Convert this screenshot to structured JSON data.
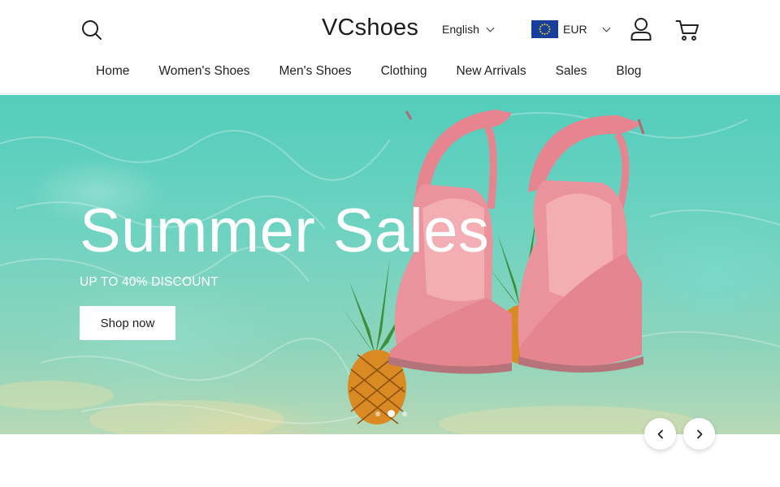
{
  "header": {
    "brand": "VCshoes",
    "language": {
      "label": "English",
      "icon": "chevron-down-icon"
    },
    "currency": {
      "code": "EUR",
      "flag": "eu-flag-icon",
      "icon": "chevron-down-icon"
    },
    "icons": {
      "search": "search-icon",
      "account": "user-icon",
      "cart": "cart-icon"
    }
  },
  "nav": {
    "items": [
      {
        "label": "Home"
      },
      {
        "label": "Women's Shoes"
      },
      {
        "label": "Men's Shoes"
      },
      {
        "label": "Clothing"
      },
      {
        "label": "New Arrivals"
      },
      {
        "label": "Sales"
      },
      {
        "label": "Blog"
      }
    ]
  },
  "hero": {
    "title": "Summer Sales",
    "subtitle": "UP TO 40% DISCOUNT",
    "cta_label": "Shop now",
    "slides_total": 3,
    "active_slide": 2
  },
  "carousel": {
    "prev_icon": "chevron-left-icon",
    "next_icon": "chevron-right-icon"
  },
  "colors": {
    "accent_text": "#ffffff",
    "water": "#5fcfc0",
    "sandal": "#e98b95",
    "flag_blue": "#173f9c",
    "flag_star": "#f7d11e"
  }
}
